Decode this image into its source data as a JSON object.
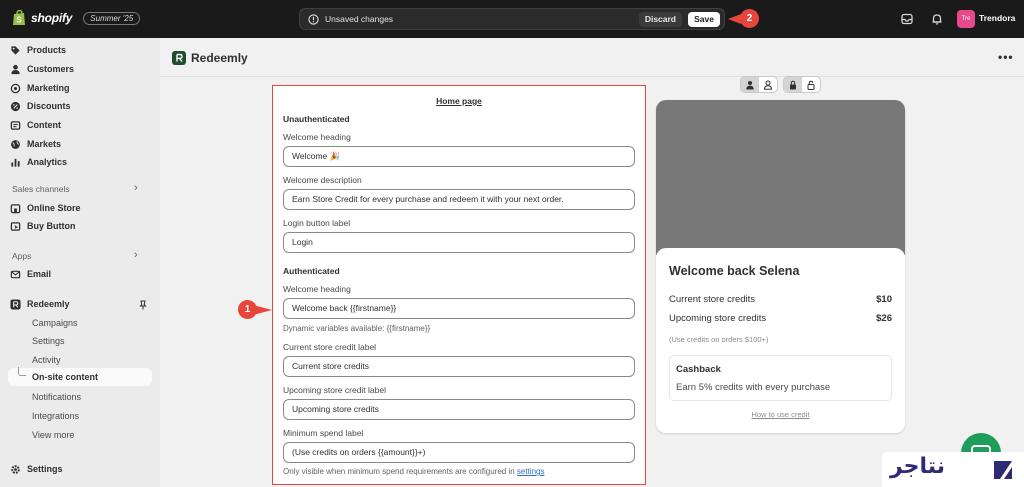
{
  "topbar": {
    "brand": "shopify",
    "edition_badge": "Summer '25",
    "unsaved_message": "Unsaved changes",
    "discard_label": "Discard",
    "save_label": "Save",
    "store_avatar": "Tre",
    "store_name": "Trendora",
    "callout_save": "2"
  },
  "sidebar": {
    "items": [
      {
        "label": "Products",
        "icon": "tag-icon"
      },
      {
        "label": "Customers",
        "icon": "person-icon"
      },
      {
        "label": "Marketing",
        "icon": "target-icon"
      },
      {
        "label": "Discounts",
        "icon": "discount-icon"
      },
      {
        "label": "Content",
        "icon": "content-icon"
      },
      {
        "label": "Markets",
        "icon": "globe-icon"
      },
      {
        "label": "Analytics",
        "icon": "bar-chart-icon"
      }
    ],
    "sales_channels_label": "Sales channels",
    "sales_channels": [
      {
        "label": "Online Store",
        "icon": "store-icon"
      },
      {
        "label": "Buy Button",
        "icon": "cursor-icon"
      }
    ],
    "apps_label": "Apps",
    "apps": [
      {
        "label": "Email",
        "icon": "email-icon"
      },
      {
        "label": "Redeemly",
        "icon": "redeemly-icon"
      }
    ],
    "redeemly_sub": [
      "Campaigns",
      "Settings",
      "Activity",
      "On-site content",
      "Notifications",
      "Integrations",
      "View more"
    ],
    "settings_label": "Settings"
  },
  "main": {
    "app_title": "Redeemly",
    "more": "•••"
  },
  "form": {
    "title": "Home page",
    "unauth_title": "Unauthenticated",
    "unauth_fields": [
      {
        "label": "Welcome heading",
        "value": "Welcome 🎉"
      },
      {
        "label": "Welcome description",
        "value": "Earn Store Credit for every purchase and redeem it with your next order."
      },
      {
        "label": "Login button label",
        "value": "Login"
      }
    ],
    "auth_title": "Authenticated",
    "auth_heading_label": "Welcome heading",
    "auth_heading_value": "Welcome back {{firstname}}",
    "auth_heading_help": "Dynamic variables available: {{firstname}}",
    "auth_fields": [
      {
        "label": "Current store credit label",
        "value": "Current store credits"
      },
      {
        "label": "Upcoming store credit label",
        "value": "Upcoming store credits"
      },
      {
        "label": "Minimum spend label",
        "value": "(Use credits on orders {{amount}}+)"
      }
    ],
    "min_help_prefix": "Only visible when minimum spend requirements are configured in ",
    "min_help_link": "settings",
    "callout_field": "1"
  },
  "preview": {
    "heading": "Welcome back Selena",
    "current_label": "Current store credits",
    "current_amount": "$10",
    "upcoming_label": "Upcoming store credits",
    "upcoming_amount": "$26",
    "note": "(Use credits on orders $100+)",
    "cashback_title": "Cashback",
    "cashback_desc": "Earn 5% credits with every purchase",
    "how_link": "How to use credit"
  },
  "watermark": {
    "text": "نتاجر"
  },
  "colors": {
    "topbar": "#1a1a1a",
    "callout": "#e8453c",
    "highlight_border": "#e8453c",
    "link": "#2c6ecb",
    "chat_fab": "#1e9e5a",
    "watermark": "#2f2a75"
  }
}
